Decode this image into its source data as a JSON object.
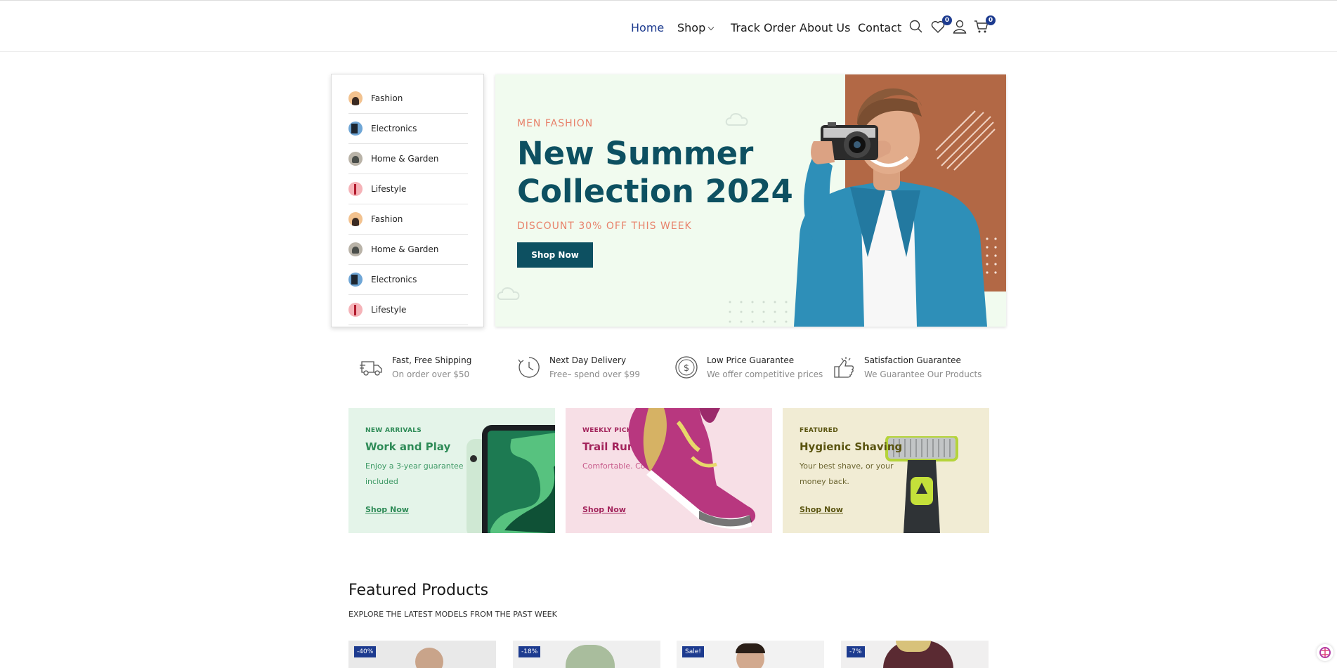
{
  "nav": {
    "items": [
      {
        "label": "Home",
        "active": true
      },
      {
        "label": "Shop"
      },
      {
        "label": "Track Order"
      },
      {
        "label": "About Us"
      },
      {
        "label": "Contact"
      }
    ],
    "wishlist_count": "0",
    "cart_count": "0",
    "icons": [
      "search-icon",
      "heart-icon",
      "user-icon",
      "cart-icon"
    ]
  },
  "categories": [
    {
      "label": "Fashion",
      "icon": "fashion"
    },
    {
      "label": "Electronics",
      "icon": "electronics"
    },
    {
      "label": "Home & Garden",
      "icon": "home"
    },
    {
      "label": "Lifestyle",
      "icon": "lifestyle"
    },
    {
      "label": "Fashion",
      "icon": "fashion"
    },
    {
      "label": "Home & Garden",
      "icon": "home"
    },
    {
      "label": "Electronics",
      "icon": "electronics"
    },
    {
      "label": "Lifestyle",
      "icon": "lifestyle"
    }
  ],
  "hero": {
    "subtitle": "MEN FASHION",
    "title": "New Summer Collection 2024",
    "discount": "DISCOUNT 30% OFF THIS WEEK",
    "button": "Shop Now"
  },
  "features": [
    {
      "title": "Fast, Free Shipping",
      "sub": "On order over $50",
      "icon": "truck-icon"
    },
    {
      "title": "Next Day Delivery",
      "sub": "Free– spend over $99",
      "icon": "clock-icon"
    },
    {
      "title": "Low Price Guarantee",
      "sub": "We offer competitive prices",
      "icon": "dollar-icon"
    },
    {
      "title": "Satisfaction Guarantee",
      "sub": "We Guarantee Our Products",
      "icon": "thumbs-up-icon"
    }
  ],
  "promos": [
    {
      "tag": "NEW ARRIVALS",
      "title": "Work and Play",
      "desc": "Enjoy a 3-year guarantee included",
      "link": "Shop Now",
      "bg": "#e4f4e9",
      "color": "#2e8b57"
    },
    {
      "tag": "WEEKLY PICKS",
      "title": "Trail Runners",
      "desc": "Comfortable. Confident.",
      "link": "Shop Now",
      "bg": "#f7dfe6",
      "color": "#a3245c"
    },
    {
      "tag": "FEATURED",
      "title": "Hygienic Shaving",
      "desc": "Your best shave, or your money back.",
      "link": "Shop Now",
      "bg": "#f1ecd4",
      "color": "#5a5410"
    }
  ],
  "featured": {
    "title": "Featured Products",
    "subtitle": "EXPLORE THE LATEST MODELS FROM THE PAST WEEK",
    "products": [
      {
        "badge": "-40%"
      },
      {
        "badge": "-18%"
      },
      {
        "badge": "Sale!"
      },
      {
        "badge": "-7%"
      }
    ]
  },
  "colors": {
    "accent": "#1d3b8f",
    "hero_teal": "#0d5061",
    "hero_coral": "#e8826b",
    "hero_bg": "#f1fbef",
    "hero_brown": "#b26845"
  }
}
